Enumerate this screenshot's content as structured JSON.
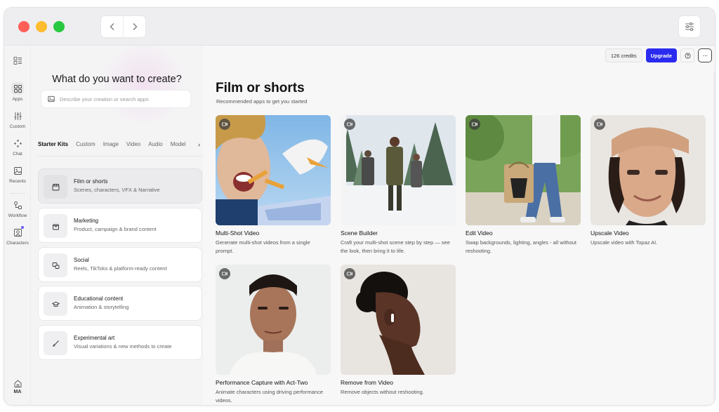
{
  "window": {
    "traffic_lights": [
      "#ff5f57",
      "#febc2e",
      "#28c840"
    ]
  },
  "nav": {
    "back_icon": "chevron-left-icon",
    "forward_icon": "chevron-right-icon",
    "settings_icon": "sliders-icon"
  },
  "rail": {
    "items": [
      {
        "label": "Apps",
        "icon": "grid-icon"
      },
      {
        "label": "Custom",
        "icon": "sliders-icon"
      },
      {
        "label": "Chat",
        "icon": "sparkle-icon"
      },
      {
        "label": "Recents",
        "icon": "image-icon"
      },
      {
        "label": "Workflow",
        "icon": "workflow-icon"
      },
      {
        "label": "Characters",
        "icon": "character-icon"
      }
    ],
    "user_initials": "MA"
  },
  "left_panel": {
    "title": "What do you want to create?",
    "search_placeholder": "Describe your creation or search apps",
    "tabs": [
      "Starter Kits",
      "Custom",
      "Image",
      "Video",
      "Audio",
      "Model"
    ],
    "kits": [
      {
        "title": "Film or shorts",
        "subtitle": "Scenes, characters, VFX & Narrative",
        "icon": "clapperboard-icon"
      },
      {
        "title": "Marketing",
        "subtitle": "Product, campaign & brand content",
        "icon": "shopping-bag-icon"
      },
      {
        "title": "Social",
        "subtitle": "Reels, TikToks & platform-ready content",
        "icon": "social-icon"
      },
      {
        "title": "Educational content",
        "subtitle": "Animation & storytelling",
        "icon": "graduation-cap-icon"
      },
      {
        "title": "Experimental art",
        "subtitle": "Visual variations & new methods to create",
        "icon": "brush-icon"
      }
    ]
  },
  "topbar": {
    "credits": "126 credits",
    "upgrade": "Upgrade",
    "help_icon": "help-icon",
    "more": "···"
  },
  "main": {
    "title": "Film or shorts",
    "subtitle": "Recommended apps to get you started",
    "cards": [
      {
        "title": "Multi-Shot Video",
        "desc": "Generate multi-shot videos from a single prompt."
      },
      {
        "title": "Scene Builder",
        "desc": "Craft your multi-shot scene step by step — see the look, then bring it to life."
      },
      {
        "title": "Edit Video",
        "desc": "Swap backgrounds, lighting, angles - all without reshooting."
      },
      {
        "title": "Upscale Video",
        "desc": "Upscale video with Topaz AI."
      },
      {
        "title": "Performance Capture with Act-Two",
        "desc": "Animate characters using driving performance videos."
      },
      {
        "title": "Remove from Video",
        "desc": "Remove objects without reshooting."
      }
    ]
  },
  "colors": {
    "accent": "#2b2bf0",
    "badge_dot": "#6b5cff"
  }
}
